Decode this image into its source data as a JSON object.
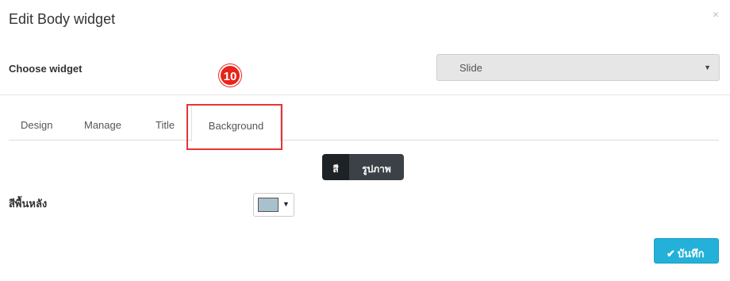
{
  "modal": {
    "title": "Edit Body widget",
    "close_glyph": "×"
  },
  "choose_widget": {
    "label": "Choose widget",
    "selected": "Slide",
    "caret_glyph": "▼"
  },
  "annotation": {
    "step_number": "10",
    "highlight_color": "#e53535"
  },
  "tabs": [
    {
      "label": "Design",
      "active": false
    },
    {
      "label": "Manage",
      "active": false
    },
    {
      "label": "Title",
      "active": false
    },
    {
      "label": "Background",
      "active": true
    }
  ],
  "background_mode": {
    "color_label": "สี",
    "image_label": "รูปภาพ",
    "selected": "สี"
  },
  "background_color": {
    "label": "สีพื้นหลัง",
    "swatch_color": "#a9c1cd",
    "caret_glyph": "▼"
  },
  "save_button": {
    "label": "บันทึก",
    "icon": "check-icon",
    "icon_glyph": "✔",
    "color": "#23b0d9"
  }
}
